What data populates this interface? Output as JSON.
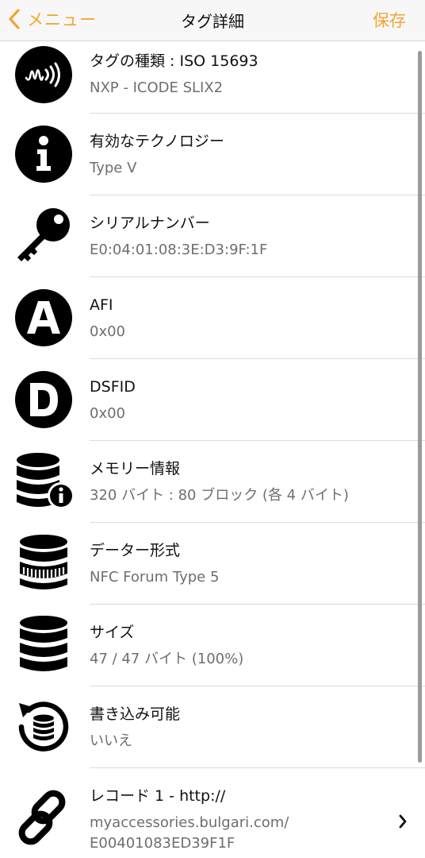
{
  "nav": {
    "back_label": "メニュー",
    "title": "タグ詳細",
    "save_label": "保存",
    "accent_color": "#f3a533"
  },
  "rows": [
    {
      "icon": "nfc-signal-icon",
      "title": "タグの種類 : ISO 15693",
      "subtitle": "NXP - ICODE SLIX2"
    },
    {
      "icon": "info-icon",
      "title": "有効なテクノロジー",
      "subtitle": "Type V"
    },
    {
      "icon": "key-icon",
      "title": "シリアルナンバー",
      "subtitle": "E0:04:01:08:3E:D3:9F:1F"
    },
    {
      "icon": "letter-a-icon",
      "title": "AFI",
      "subtitle": "0x00"
    },
    {
      "icon": "letter-d-icon",
      "title": "DSFID",
      "subtitle": "0x00"
    },
    {
      "icon": "database-info-icon",
      "title": "メモリー情報",
      "subtitle": "320 バイト : 80 ブロック (各 4 バイト)"
    },
    {
      "icon": "database-format-icon",
      "title": "データー形式",
      "subtitle": "NFC Forum Type 5"
    },
    {
      "icon": "database-icon",
      "title": "サイズ",
      "subtitle": "47 / 47 バイト (100%)"
    },
    {
      "icon": "database-rewrite-icon",
      "title": "書き込み可能",
      "subtitle": "いいえ"
    },
    {
      "icon": "link-icon",
      "title": "レコード 1 - http://",
      "subtitle_lines": [
        "myaccessories.bulgari.com/",
        "E00401083ED39F1F"
      ]
    }
  ]
}
